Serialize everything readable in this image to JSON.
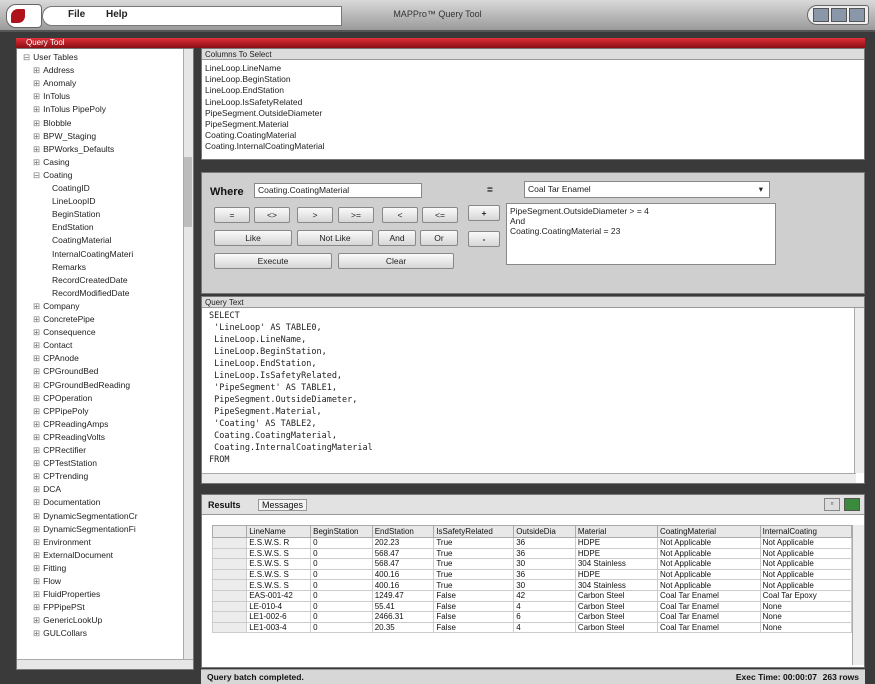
{
  "window": {
    "title": "MAPPro™ Query Tool",
    "menu": [
      "File",
      "Help"
    ]
  },
  "query_tool_label": "Query Tool",
  "tree": {
    "items": [
      {
        "label": "User Tables",
        "level": 0,
        "prefix": "⊟"
      },
      {
        "label": "Address",
        "level": 1,
        "prefix": "⊞"
      },
      {
        "label": "Anomaly",
        "level": 1,
        "prefix": "⊞"
      },
      {
        "label": "InTolus",
        "level": 1,
        "prefix": "⊞"
      },
      {
        "label": "InTolus PipePoly",
        "level": 1,
        "prefix": "⊞"
      },
      {
        "label": "Blobble",
        "level": 1,
        "prefix": "⊞"
      },
      {
        "label": "BPW_Staging",
        "level": 1,
        "prefix": "⊞"
      },
      {
        "label": "BPWorks_Defaults",
        "level": 1,
        "prefix": "⊞"
      },
      {
        "label": "Casing",
        "level": 1,
        "prefix": "⊞"
      },
      {
        "label": "Coating",
        "level": 1,
        "prefix": "⊟"
      },
      {
        "label": "CoatingID",
        "level": 2,
        "prefix": ""
      },
      {
        "label": "LineLoopID",
        "level": 2,
        "prefix": ""
      },
      {
        "label": "BeginStation",
        "level": 2,
        "prefix": ""
      },
      {
        "label": "EndStation",
        "level": 2,
        "prefix": ""
      },
      {
        "label": "CoatingMaterial",
        "level": 2,
        "prefix": ""
      },
      {
        "label": "InternalCoatingMateri",
        "level": 2,
        "prefix": ""
      },
      {
        "label": "Remarks",
        "level": 2,
        "prefix": ""
      },
      {
        "label": "RecordCreatedDate",
        "level": 2,
        "prefix": ""
      },
      {
        "label": "RecordModifiedDate",
        "level": 2,
        "prefix": ""
      },
      {
        "label": "Company",
        "level": 1,
        "prefix": "⊞"
      },
      {
        "label": "ConcretePipe",
        "level": 1,
        "prefix": "⊞"
      },
      {
        "label": "Consequence",
        "level": 1,
        "prefix": "⊞"
      },
      {
        "label": "Contact",
        "level": 1,
        "prefix": "⊞"
      },
      {
        "label": "CPAnode",
        "level": 1,
        "prefix": "⊞"
      },
      {
        "label": "CPGroundBed",
        "level": 1,
        "prefix": "⊞"
      },
      {
        "label": "CPGroundBedReading",
        "level": 1,
        "prefix": "⊞"
      },
      {
        "label": "CPOperation",
        "level": 1,
        "prefix": "⊞"
      },
      {
        "label": "CPPipePoly",
        "level": 1,
        "prefix": "⊞"
      },
      {
        "label": "CPReadingAmps",
        "level": 1,
        "prefix": "⊞"
      },
      {
        "label": "CPReadingVolts",
        "level": 1,
        "prefix": "⊞"
      },
      {
        "label": "CPRectifier",
        "level": 1,
        "prefix": "⊞"
      },
      {
        "label": "CPTestStation",
        "level": 1,
        "prefix": "⊞"
      },
      {
        "label": "CPTrending",
        "level": 1,
        "prefix": "⊞"
      },
      {
        "label": "DCA",
        "level": 1,
        "prefix": "⊞"
      },
      {
        "label": "Documentation",
        "level": 1,
        "prefix": "⊞"
      },
      {
        "label": "DynamicSegmentationCr",
        "level": 1,
        "prefix": "⊞"
      },
      {
        "label": "DynamicSegmentationFi",
        "level": 1,
        "prefix": "⊞"
      },
      {
        "label": "Environment",
        "level": 1,
        "prefix": "⊞"
      },
      {
        "label": "ExternalDocument",
        "level": 1,
        "prefix": "⊞"
      },
      {
        "label": "Fitting",
        "level": 1,
        "prefix": "⊞"
      },
      {
        "label": "Flow",
        "level": 1,
        "prefix": "⊞"
      },
      {
        "label": "FluidProperties",
        "level": 1,
        "prefix": "⊞"
      },
      {
        "label": "FPPipePSt",
        "level": 1,
        "prefix": "⊞"
      },
      {
        "label": "GenericLookUp",
        "level": 1,
        "prefix": "⊞"
      },
      {
        "label": "GULCollars",
        "level": 1,
        "prefix": "⊞"
      }
    ]
  },
  "columns": {
    "header": "Columns To Select",
    "items": [
      "LineLoop.LineName",
      "LineLoop.BeginStation",
      "LineLoop.EndStation",
      "LineLoop.IsSafetyRelated",
      "PipeSegment.OutsideDiameter",
      "PipeSegment.Material",
      "Coating.CoatingMaterial",
      "Coating.InternalCoatingMaterial"
    ]
  },
  "where": {
    "label": "Where",
    "field": "Coating.CoatingMaterial",
    "operator": "=",
    "value": "Coal Tar Enamel",
    "ops_row1": [
      "=",
      "<>",
      ">",
      ">=",
      "<",
      "<="
    ],
    "like": "Like",
    "not_like": "Not Like",
    "and": "And",
    "or": "Or",
    "execute": "Execute",
    "clear": "Clear",
    "add": "+",
    "remove": "-",
    "conditions": [
      "PipeSegment.OutsideDiameter > = 4",
      "And",
      "Coating.CoatingMaterial = 23"
    ]
  },
  "query": {
    "header": "Query Text",
    "lines": [
      "SELECT",
      " 'LineLoop' AS TABLE0,",
      " LineLoop.LineName,",
      " LineLoop.BeginStation,",
      " LineLoop.EndStation,",
      " LineLoop.IsSafetyRelated,",
      " 'PipeSegment' AS TABLE1,",
      " PipeSegment.OutsideDiameter,",
      " PipeSegment.Material,",
      " 'Coating' AS TABLE2,",
      " Coating.CoatingMaterial,",
      " Coating.InternalCoatingMaterial",
      "FROM"
    ]
  },
  "results": {
    "tabs": [
      "Results",
      "Messages"
    ],
    "columns": [
      "LineName",
      "BeginStation",
      "EndStation",
      "IsSafetyRelated",
      "OutsideDia",
      "Material",
      "CoatingMaterial",
      "InternalCoating"
    ],
    "rows": [
      [
        "E.S.W.S. R",
        "0",
        "202.23",
        "True",
        "36",
        "HDPE",
        "Not Applicable",
        "Not Applicable"
      ],
      [
        "E.S.W.S. S",
        "0",
        "568.47",
        "True",
        "36",
        "HDPE",
        "Not Applicable",
        "Not Applicable"
      ],
      [
        "E.S.W.S. S",
        "0",
        "568.47",
        "True",
        "30",
        "304 Stainless",
        "Not Applicable",
        "Not Applicable"
      ],
      [
        "E.S.W.S. S",
        "0",
        "400.16",
        "True",
        "36",
        "HDPE",
        "Not Applicable",
        "Not Applicable"
      ],
      [
        "E.S.W.S. S",
        "0",
        "400.16",
        "True",
        "30",
        "304 Stainless",
        "Not Applicable",
        "Not Applicable"
      ],
      [
        "EAS-001-42",
        "0",
        "1249.47",
        "False",
        "42",
        "Carbon Steel",
        "Coal Tar Enamel",
        "Coal Tar Epoxy"
      ],
      [
        "LE-010-4",
        "0",
        "55.41",
        "False",
        "4",
        "Carbon Steel",
        "Coal Tar Enamel",
        "None"
      ],
      [
        "LE1-002-6",
        "0",
        "2466.31",
        "False",
        "6",
        "Carbon Steel",
        "Coal Tar Enamel",
        "None"
      ],
      [
        "LE1-003-4",
        "0",
        "20.35",
        "False",
        "4",
        "Carbon Steel",
        "Coal Tar Enamel",
        "None"
      ]
    ]
  },
  "status": {
    "message": "Query batch completed.",
    "exec_time": "Exec Time: 00:00:07",
    "rows": "263 rows"
  }
}
